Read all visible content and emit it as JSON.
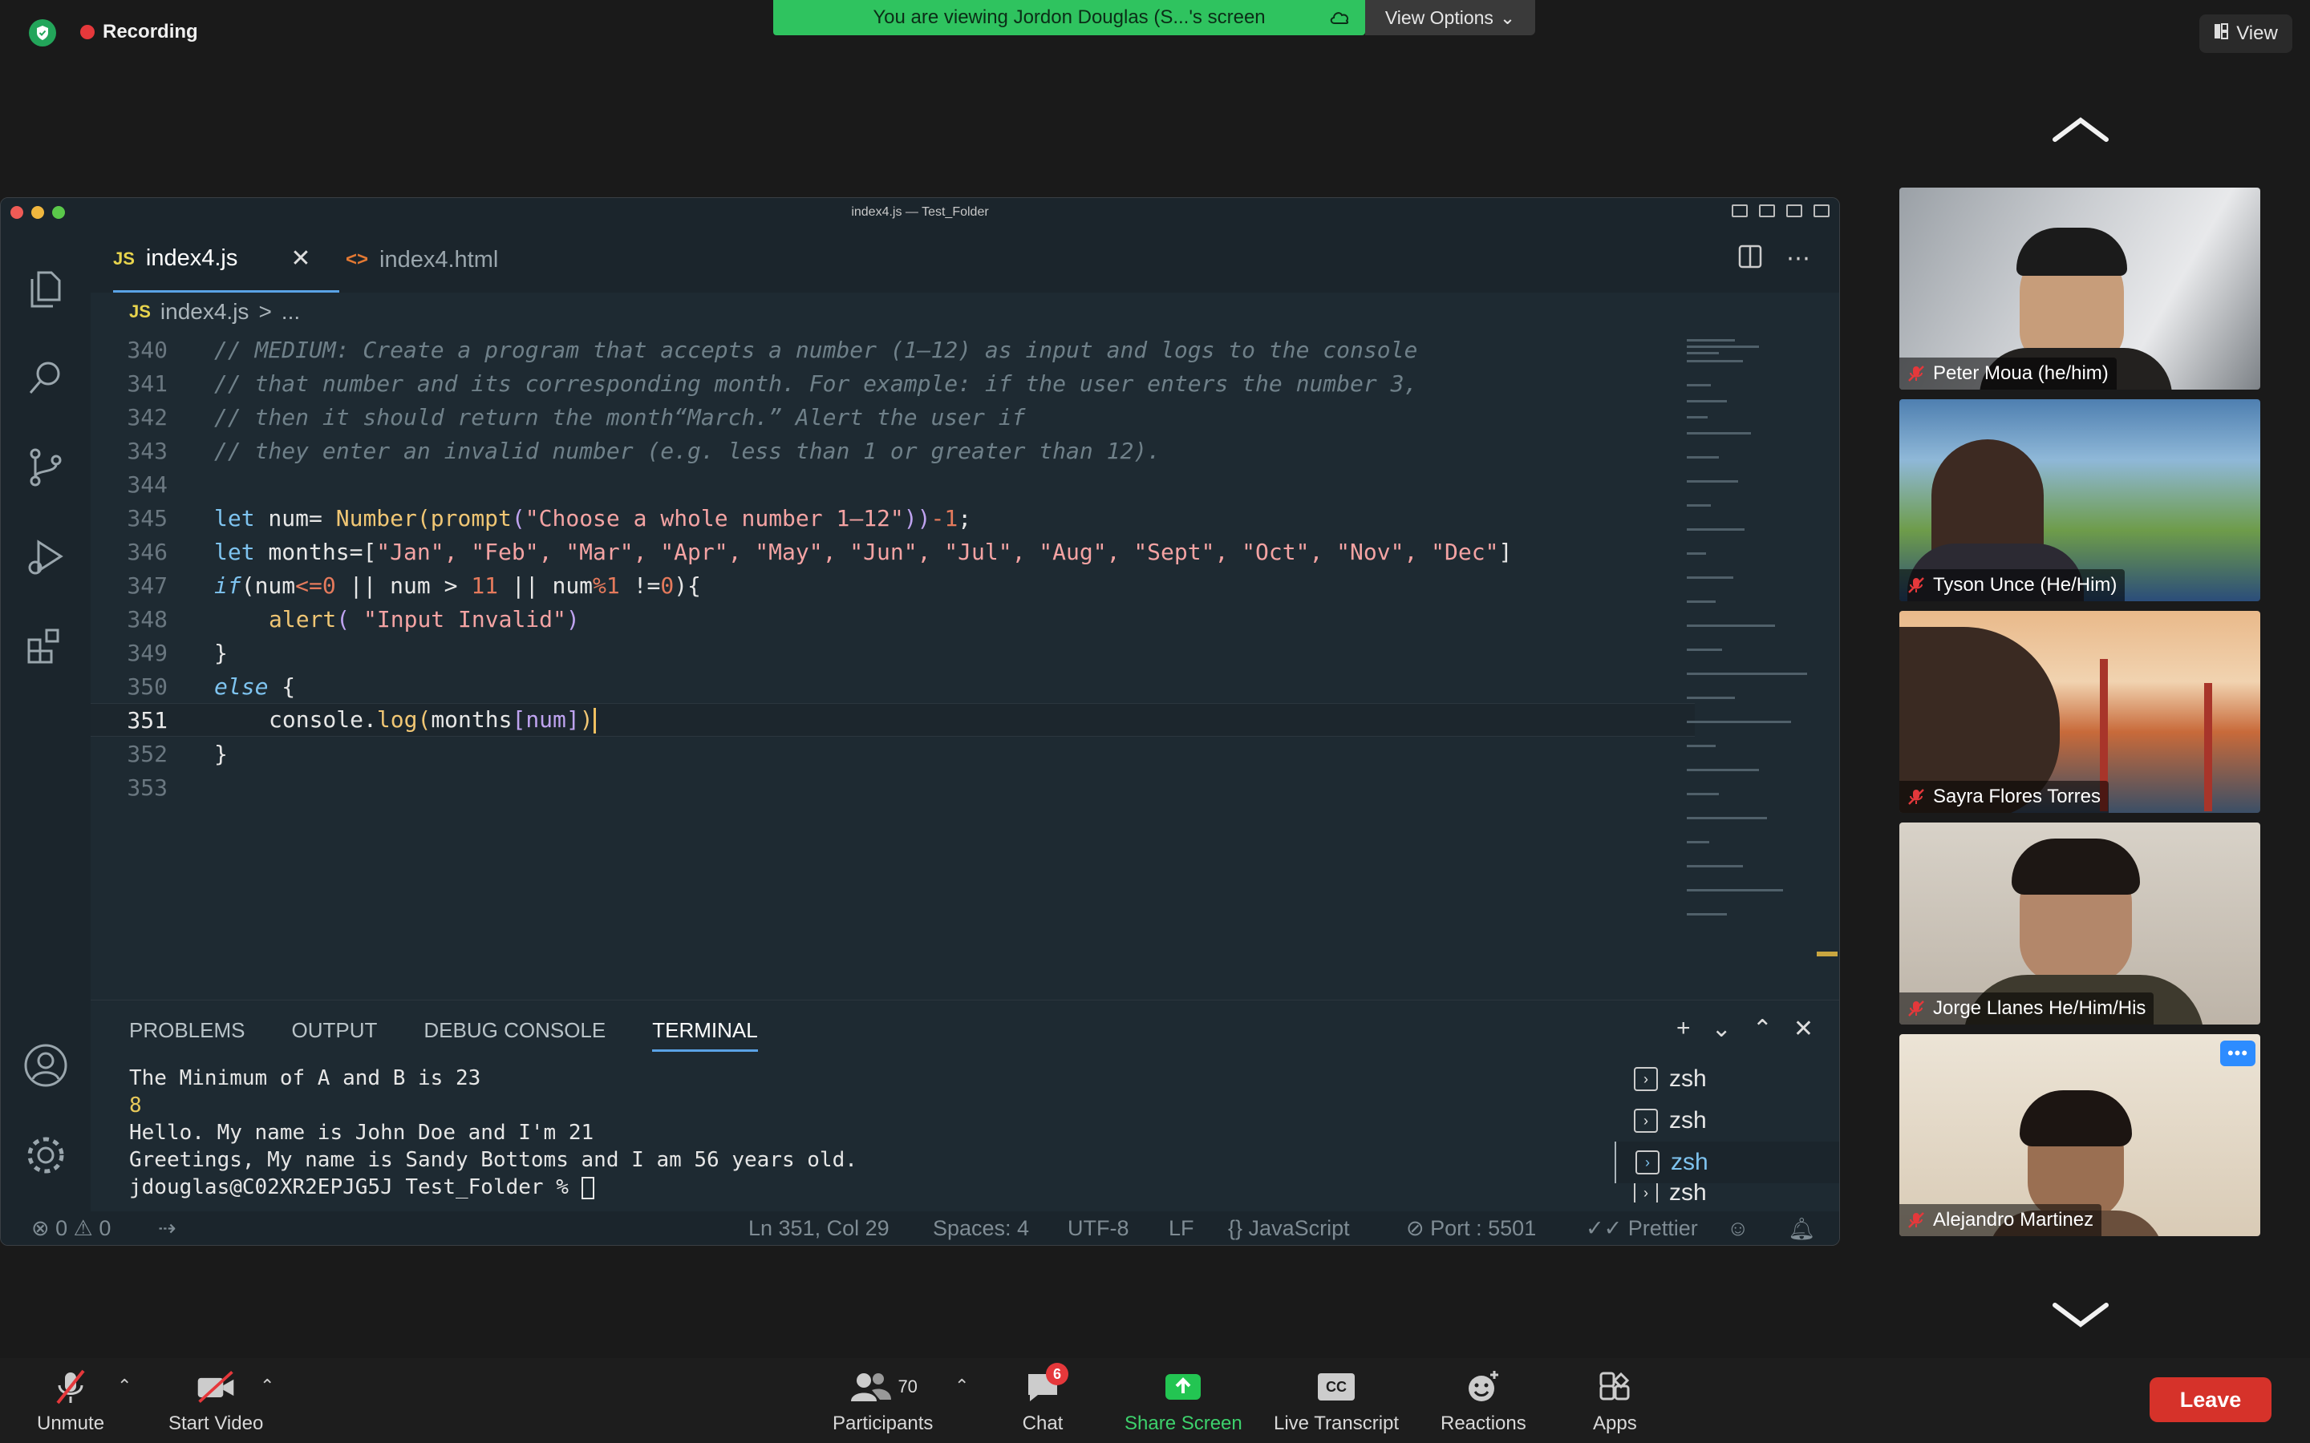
{
  "zoom": {
    "recording_label": "Recording",
    "viewing_banner": "You are viewing Jordon Douglas (S...'s screen",
    "view_options_label": "View Options",
    "view_button_label": "View",
    "participants": [
      {
        "name": "Peter Moua (he/him)"
      },
      {
        "name": "Tyson Unce  (He/Him)"
      },
      {
        "name": "Sayra Flores Torres"
      },
      {
        "name": "Jorge Llanes He/Him/His"
      },
      {
        "name": "Alejandro Martinez"
      }
    ],
    "toolbar": {
      "unmute": "Unmute",
      "start_video": "Start Video",
      "participants_label": "Participants",
      "participants_count": "70",
      "chat_label": "Chat",
      "chat_badge": "6",
      "share_screen": "Share Screen",
      "live_transcript": "Live Transcript",
      "cc_text": "CC",
      "reactions": "Reactions",
      "apps": "Apps",
      "leave": "Leave"
    }
  },
  "vscode": {
    "window_title": "index4.js — Test_Folder",
    "tabs": [
      {
        "badge": "JS",
        "label": "index4.js",
        "active": true
      },
      {
        "badge": "<>",
        "label": "index4.html",
        "active": false
      }
    ],
    "breadcrumb": {
      "badge": "JS",
      "file": "index4.js",
      "sep": ">",
      "rest": "..."
    },
    "line_numbers": [
      "340",
      "341",
      "342",
      "343",
      "344",
      "345",
      "346",
      "347",
      "348",
      "349",
      "350",
      "351",
      "352",
      "353"
    ],
    "code_lines": {
      "l340": "// MEDIUM: Create a program that accepts a number (1–12) as input and logs to the console",
      "l341": "// that number and its corresponding month. For example: if the user enters the number 3,",
      "l342": "// then it should return the month“March.” Alert the user if",
      "l343": "// they enter an invalid number (e.g. less than 1 or greater than 12).",
      "l345": {
        "kw": "let",
        "var": " num= ",
        "fn": "Number",
        "p1": "(",
        "fn2": "prompt",
        "p2": "(",
        "str": "\"Choose a whole number 1–12\"",
        "p3": "))",
        "op": "-",
        "num": "1",
        "end": ";"
      },
      "l346": {
        "kw": "let",
        "rest": " months=[",
        "items": "\"Jan\", \"Feb\", \"Mar\", \"Apr\", \"May\", \"Jun\", \"Jul\", \"Aug\", \"Sept\", \"Oct\", \"Nov\", \"Dec\"",
        "end": "]"
      },
      "l347": {
        "kw": "if",
        "a": "(num",
        "op1": "<=",
        "n0": "0",
        "b": " || num > ",
        "n11": "11",
        "c": " || num",
        "op2": "%",
        "n1": "1",
        "d": " !=",
        "n0b": "0",
        "e": "){"
      },
      "l348": {
        "fn": "alert",
        "a": "( ",
        "str": "\"Input Invalid\"",
        "b": ")"
      },
      "l349": "}",
      "l350": {
        "kw": "else",
        "rest": " {"
      },
      "l351": {
        "obj": "console",
        "dot": ".",
        "fn": "log",
        "a": "(",
        "arr": "months",
        "b": "[num]",
        "c": ")"
      },
      "l352": "}"
    },
    "panel": {
      "tabs": [
        "PROBLEMS",
        "OUTPUT",
        "DEBUG CONSOLE",
        "TERMINAL"
      ],
      "terminal_lines": [
        "The Minimum of A and B is 23",
        "8",
        "Hello. My name is John Doe and I'm 21",
        "Greetings, My name is Sandy Bottoms and I am 56 years old.",
        "jdouglas@C02XR2EPJG5J Test_Folder % "
      ],
      "shells": [
        "zsh",
        "zsh",
        "zsh",
        "zsh"
      ]
    },
    "statusbar": {
      "errors": "0",
      "warnings": "0",
      "position": "Ln 351, Col 29",
      "spaces": "Spaces: 4",
      "encoding": "UTF-8",
      "eol": "LF",
      "language": "JavaScript",
      "port": "Port : 5501",
      "prettier": "Prettier"
    }
  },
  "colors": {
    "zoom_green": "#2fc35f",
    "leave_red": "#d6322a",
    "accent_blue": "#5aa3e6",
    "editor_bg": "#1e2a32"
  }
}
